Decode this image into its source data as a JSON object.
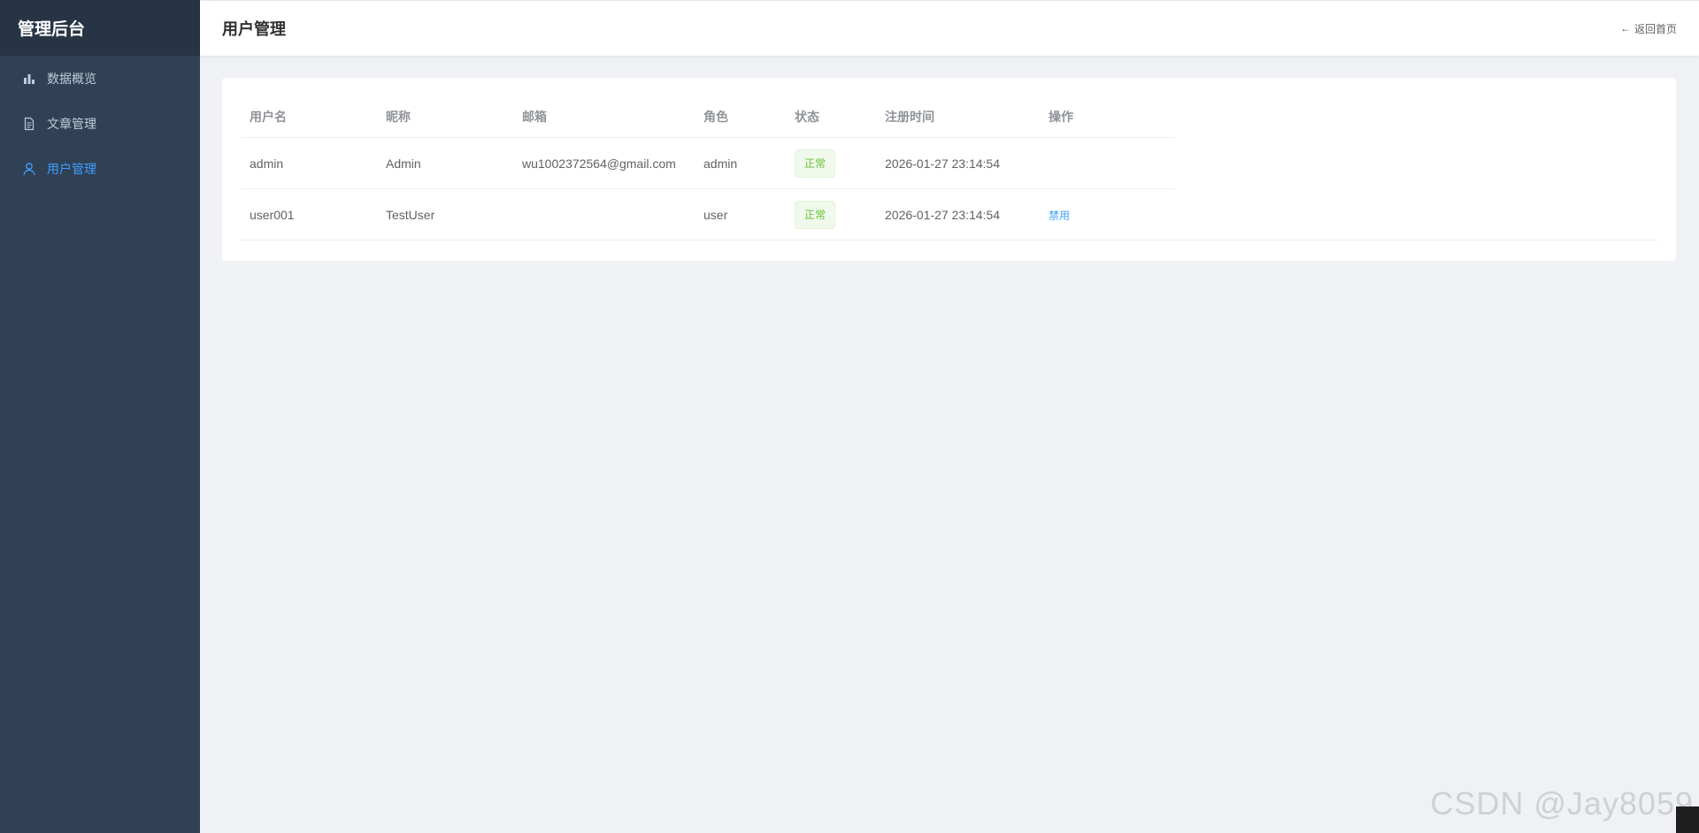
{
  "sidebar": {
    "title": "管理后台",
    "items": [
      {
        "label": "数据概览",
        "icon": "bar-chart-icon",
        "active": false
      },
      {
        "label": "文章管理",
        "icon": "document-icon",
        "active": false
      },
      {
        "label": "用户管理",
        "icon": "user-icon",
        "active": true
      }
    ]
  },
  "header": {
    "title": "用户管理",
    "back_arrow": "←",
    "back_label": "返回首页"
  },
  "table": {
    "columns": [
      "用户名",
      "昵称",
      "邮箱",
      "角色",
      "状态",
      "注册时间",
      "操作"
    ],
    "rows": [
      {
        "username": "admin",
        "nickname": "Admin",
        "email": "wu1002372564@gmail.com",
        "role": "admin",
        "status": "正常",
        "registered": "2026-01-27 23:14:54",
        "action": ""
      },
      {
        "username": "user001",
        "nickname": "TestUser",
        "email": "",
        "role": "user",
        "status": "正常",
        "registered": "2026-01-27 23:14:54",
        "action": "禁用"
      }
    ]
  },
  "watermark": "CSDN @Jay8059",
  "colors": {
    "sidebar_bg": "#304156",
    "sidebar_header_bg": "#263445",
    "accent": "#409eff",
    "success": "#67c23a",
    "page_bg": "#eff1f5"
  }
}
